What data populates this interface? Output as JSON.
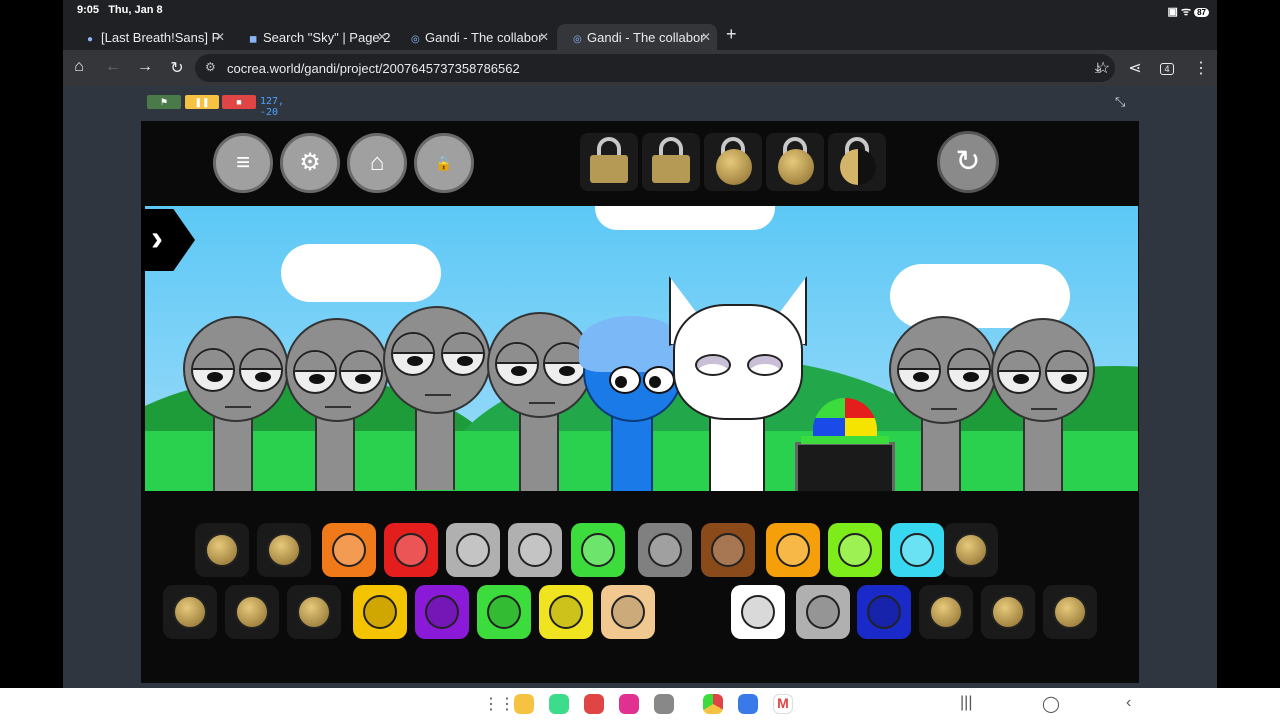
{
  "status": {
    "time": "9:05",
    "date": "Thu, Jan 8",
    "battery": "87"
  },
  "tabs": [
    {
      "title": "[Last Breath!Sans] P",
      "active": false
    },
    {
      "title": "Search \"Sky\" | Page 2",
      "active": false
    },
    {
      "title": "Gandi - The collabor",
      "active": false
    },
    {
      "title": "Gandi - The collabor",
      "active": true
    }
  ],
  "toolbar": {
    "url": "cocrea.world/gandi/project/2007645737358786562",
    "tab_count": "4"
  },
  "project": {
    "coords": "127, -20"
  },
  "icons": {
    "menu": "menu-icon",
    "settings": "gear-icon",
    "save": "save-icon",
    "password": "password-icon",
    "reload": "reload-icon",
    "arrow": "chevron-right-icon"
  },
  "colors": {
    "sky": "#5cc8f6",
    "ground": "#29d14f",
    "stage_bg": "#0a0a0a",
    "accent_green": "#4a7a4a",
    "accent_yellow": "#f5c242",
    "accent_red": "#e04545"
  },
  "characters": [
    {
      "kind": "gray"
    },
    {
      "kind": "gray"
    },
    {
      "kind": "gray"
    },
    {
      "kind": "gray"
    },
    {
      "kind": "blue"
    },
    {
      "kind": "white-cat"
    },
    {
      "kind": "propeller-hat"
    },
    {
      "kind": "gray"
    },
    {
      "kind": "gray"
    }
  ],
  "palette_row1": [
    "#1a1a1a",
    "#1a1a1a",
    "#f07a1a",
    "#e41d1d",
    "#b0b0b0",
    "#b0b0b0",
    "#3ddc3d",
    "#808080",
    "#8a4a1a",
    "#f5a00a",
    "#7dec1a",
    "#38d8f0",
    "#1a1a1a"
  ],
  "palette_row2": [
    "#1a1a1a",
    "#1a1a1a",
    "#1a1a1a",
    "#f5c400",
    "#8a1ad8",
    "#3ddc3d",
    "#f0e420",
    "#f0c890",
    "#ffffff",
    "#b0b0b0",
    "#1a2ac8",
    "#1a1a1a",
    "#1a1a1a",
    "#1a1a1a"
  ]
}
